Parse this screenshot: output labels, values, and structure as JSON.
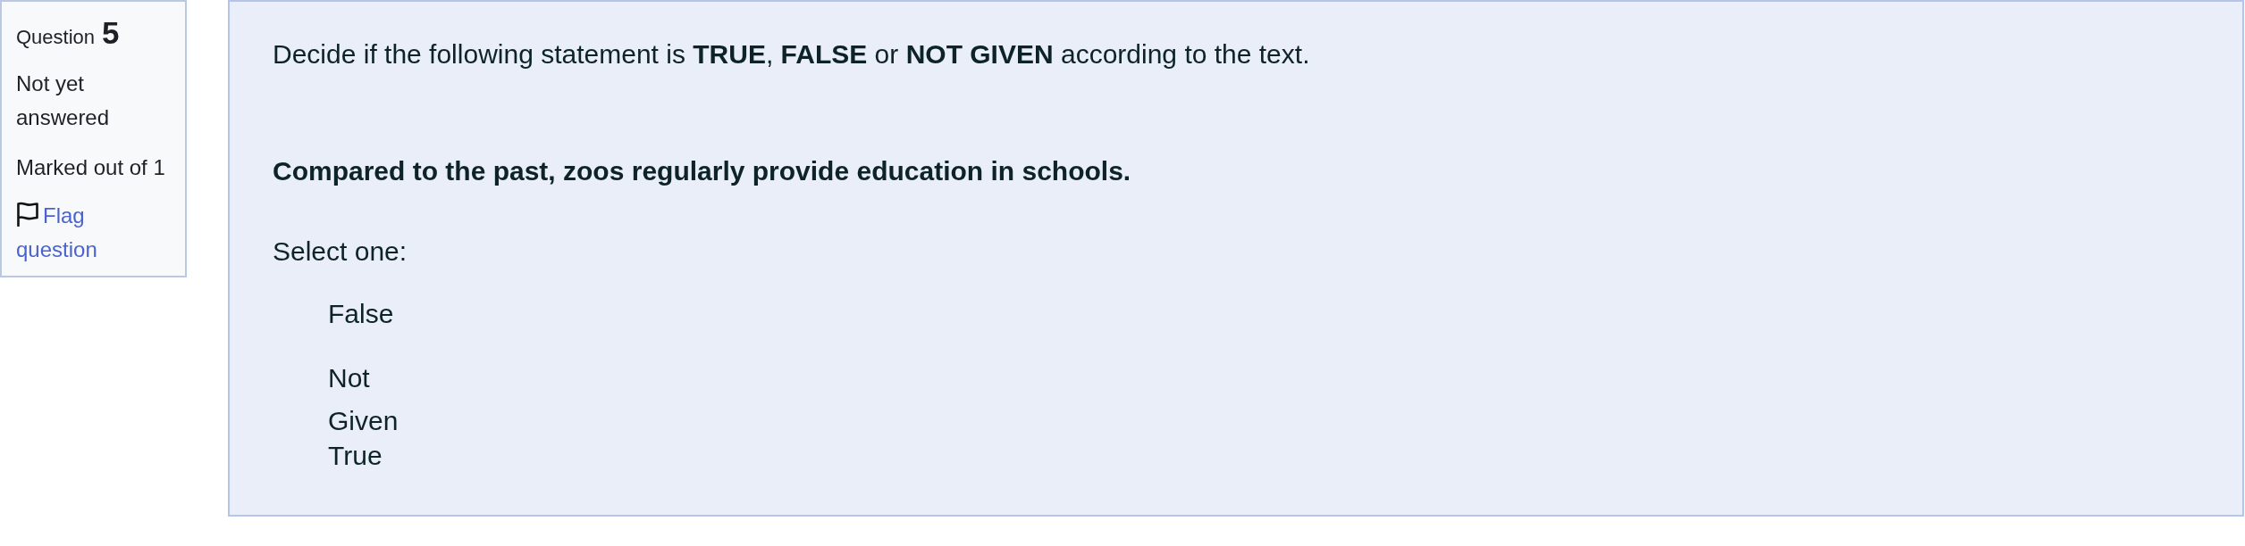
{
  "question_info": {
    "label": "Question",
    "number": "5",
    "state": "Not yet answered",
    "grade": "Marked out of 1",
    "flag_link": "Flag question"
  },
  "question": {
    "instruction": "Decide if the following statement is **TRUE**, **FALSE** or **NOT GIVEN** according to the text.",
    "statement": "Compared to the past, zoos regularly provide education in schools.",
    "prompt": "Select one:",
    "options": [
      "False",
      "Not Given",
      "True"
    ]
  }
}
